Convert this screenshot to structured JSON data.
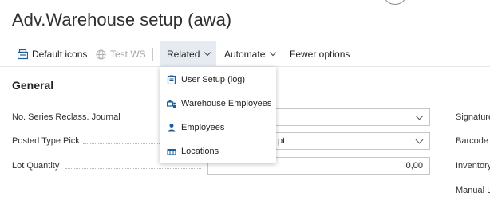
{
  "page": {
    "title": "Adv.Warehouse setup (awa)"
  },
  "toolbar": {
    "items": [
      {
        "label": "Default icons",
        "icon": "default-icons-icon"
      },
      {
        "label": "Test WS",
        "icon": "globe-icon",
        "disabled": true
      },
      {
        "label": "Related",
        "icon": "chevron-down-icon",
        "active": true
      },
      {
        "label": "Automate",
        "icon": "chevron-down-icon"
      },
      {
        "label": "Fewer options"
      }
    ]
  },
  "section": {
    "title": "General"
  },
  "fields": [
    {
      "label": "No. Series Reclass. Journal",
      "value": "",
      "type": "dropdown"
    },
    {
      "label": "Posted Type Pick",
      "value": "pt",
      "type": "dropdown"
    },
    {
      "label": "Lot Quantity",
      "value": "0,00",
      "type": "number"
    }
  ],
  "right_labels": [
    "Signature",
    "Barcode",
    "Inventory",
    "Manual L"
  ],
  "related_menu": {
    "items": [
      {
        "label": "User Setup (log)",
        "icon": "clipboard-icon"
      },
      {
        "label": "Warehouse Employees",
        "icon": "warehouse-employees-icon"
      },
      {
        "label": "Employees",
        "icon": "person-icon"
      },
      {
        "label": "Locations",
        "icon": "locations-icon"
      }
    ]
  },
  "colors": {
    "accent": "#1d5f96",
    "menu_active_bg": "#e6ebf1"
  }
}
